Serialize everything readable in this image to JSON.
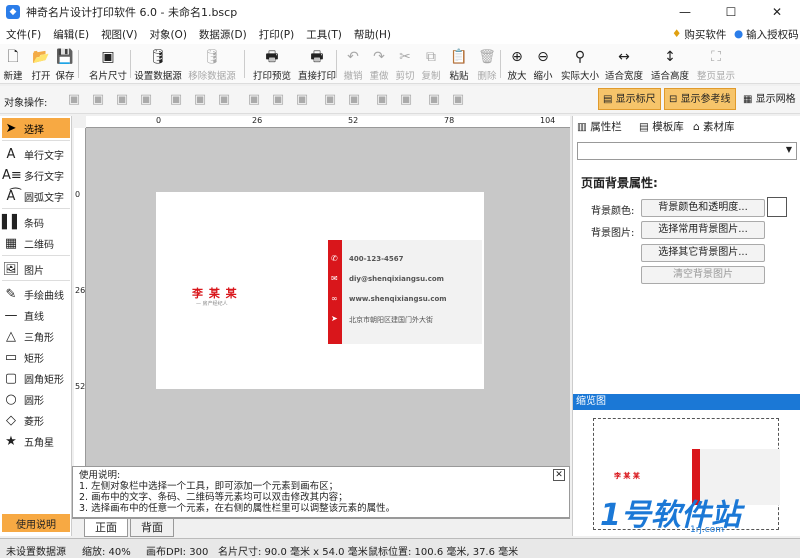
{
  "window": {
    "title": "神奇名片设计打印软件 6.0 - 未命名1.bscp",
    "minimize": "—",
    "maximize": "☐",
    "close": "✕"
  },
  "menu": [
    "文件(F)",
    "编辑(E)",
    "视图(V)",
    "对象(O)",
    "数据源(D)",
    "打印(P)",
    "工具(T)",
    "帮助(H)"
  ],
  "menu_right": {
    "buy": "购买软件",
    "auth": "输入授权码"
  },
  "toolbar": [
    {
      "label": "新建",
      "icon": "new-icon",
      "glyph": "🗋",
      "dis": false
    },
    {
      "label": "打开",
      "icon": "open-icon",
      "glyph": "📂",
      "dis": false
    },
    {
      "label": "保存",
      "icon": "save-icon",
      "glyph": "💾",
      "dis": false
    },
    {
      "label": "名片尺寸",
      "icon": "card-size-icon",
      "glyph": "▣",
      "dis": false
    },
    {
      "label": "设置数据源",
      "icon": "datasource-icon",
      "glyph": "🛢",
      "dis": false
    },
    {
      "label": "移除数据源",
      "icon": "remove-datasource-icon",
      "glyph": "🛢",
      "dis": true
    },
    {
      "label": "打印预览",
      "icon": "print-preview-icon",
      "glyph": "🖶",
      "dis": false
    },
    {
      "label": "直接打印",
      "icon": "print-icon",
      "glyph": "🖶",
      "dis": false
    },
    {
      "label": "撤销",
      "icon": "undo-icon",
      "glyph": "↶",
      "dis": true
    },
    {
      "label": "重做",
      "icon": "redo-icon",
      "glyph": "↷",
      "dis": true
    },
    {
      "label": "剪切",
      "icon": "cut-icon",
      "glyph": "✂",
      "dis": true
    },
    {
      "label": "复制",
      "icon": "copy-icon",
      "glyph": "⧉",
      "dis": true
    },
    {
      "label": "粘贴",
      "icon": "paste-icon",
      "glyph": "📋",
      "dis": false
    },
    {
      "label": "删除",
      "icon": "delete-icon",
      "glyph": "🗑",
      "dis": true
    },
    {
      "label": "放大",
      "icon": "zoom-in-icon",
      "glyph": "⊕",
      "dis": false
    },
    {
      "label": "缩小",
      "icon": "zoom-out-icon",
      "glyph": "⊖",
      "dis": false
    },
    {
      "label": "实际大小",
      "icon": "actual-size-icon",
      "glyph": "⚲",
      "dis": false
    },
    {
      "label": "适合宽度",
      "icon": "fit-width-icon",
      "glyph": "↔",
      "dis": false
    },
    {
      "label": "适合高度",
      "icon": "fit-height-icon",
      "glyph": "↕",
      "dis": false
    },
    {
      "label": "整页显示",
      "icon": "fit-page-icon",
      "glyph": "⛶",
      "dis": true
    }
  ],
  "objbar": {
    "label": "对象操作:",
    "show_ruler": "显示标尺",
    "show_guides": "显示参考线",
    "show_grid": "显示网格"
  },
  "tools": [
    {
      "label": "选择",
      "icon": "pointer-icon",
      "glyph": "➤"
    },
    {
      "label": "单行文字",
      "icon": "single-text-icon",
      "glyph": "A"
    },
    {
      "label": "多行文字",
      "icon": "multi-text-icon",
      "glyph": "A≡"
    },
    {
      "label": "圆弧文字",
      "icon": "arc-text-icon",
      "glyph": "A͡"
    },
    {
      "label": "条码",
      "icon": "barcode-icon",
      "glyph": "▌▌"
    },
    {
      "label": "二维码",
      "icon": "qrcode-icon",
      "glyph": "▦"
    },
    {
      "label": "图片",
      "icon": "image-icon",
      "glyph": "🖼"
    },
    {
      "label": "手绘曲线",
      "icon": "pen-icon",
      "glyph": "✎"
    },
    {
      "label": "直线",
      "icon": "line-icon",
      "glyph": "—"
    },
    {
      "label": "三角形",
      "icon": "triangle-icon",
      "glyph": "△"
    },
    {
      "label": "矩形",
      "icon": "rectangle-icon",
      "glyph": "▭"
    },
    {
      "label": "圆角矩形",
      "icon": "rounded-rect-icon",
      "glyph": "▢"
    },
    {
      "label": "圆形",
      "icon": "circle-icon",
      "glyph": "○"
    },
    {
      "label": "菱形",
      "icon": "diamond-icon",
      "glyph": "◇"
    },
    {
      "label": "五角星",
      "icon": "star-icon",
      "glyph": "★"
    }
  ],
  "help_button": "使用说明",
  "ruler": {
    "top": [
      "0",
      "26",
      "52",
      "78",
      "104"
    ],
    "left": [
      "0",
      "26",
      "52"
    ]
  },
  "card": {
    "name": "李 某 某",
    "subtitle": "房产经纪人",
    "phone": "400-123-4567",
    "email": "diy@shenqixiangsu.com",
    "web": "www.shenqixiangsu.com",
    "addr": "北京市朝阳区建国门外大街"
  },
  "help": {
    "title": "使用说明:",
    "l1": "1. 左侧对象栏中选择一个工具，即可添加一个元素到画布区；",
    "l2": "2. 画布中的文字、条码、二维码等元素均可以双击修改其内容；",
    "l3": "3. 选择画布中的任意一个元素，在右侧的属性栏里可以调整该元素的属性。"
  },
  "page_tabs": {
    "front": "正面",
    "back": "背面"
  },
  "right": {
    "tabs": [
      "属性栏",
      "模板库",
      "素材库"
    ],
    "heading": "页面背景属性:",
    "bg_color_label": "背景颜色:",
    "bg_color_btn": "背景颜色和透明度...",
    "bg_image_label": "背景图片:",
    "btn_common": "选择常用背景图片...",
    "btn_other": "选择其它背景图片...",
    "btn_clear": "清空背景图片",
    "preview_title": "缩览图"
  },
  "watermark": {
    "big": "1号软件站",
    "small": "1rj.com"
  },
  "status": {
    "ds": "未设置数据源",
    "zoom": "缩放: 40%",
    "dpi": "画布DPI: 300",
    "size": "名片尺寸: 90.0 毫米 x 54.0 毫米",
    "mouse": "鼠标位置: 100.6 毫米, 37.6 毫米"
  },
  "colors": {
    "accent": "#f7a943",
    "red": "#d9161b",
    "blue": "#1b78d6"
  }
}
